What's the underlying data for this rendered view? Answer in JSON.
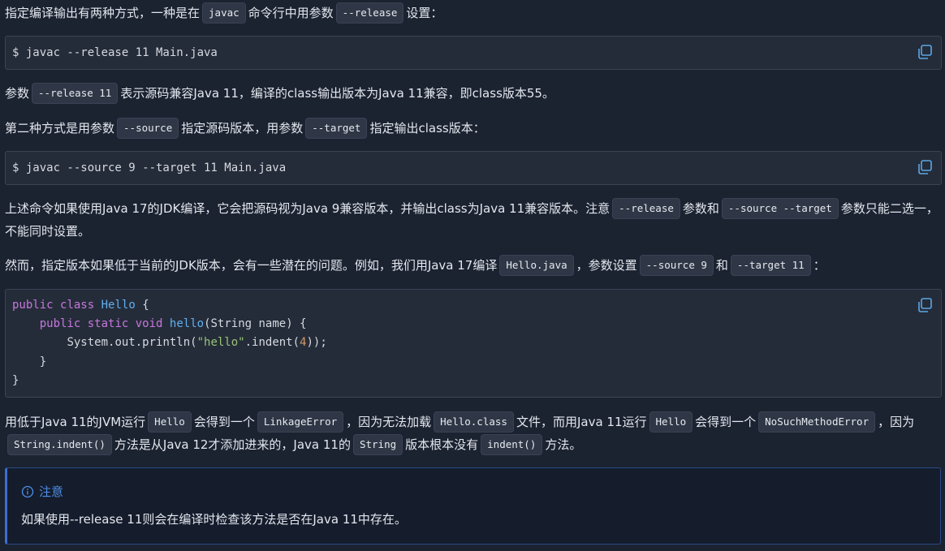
{
  "p1": {
    "t1": "指定编译输出有两种方式，一种是在",
    "c1": "javac",
    "t2": "命令行中用参数",
    "c2": "--release",
    "t3": "设置："
  },
  "code1": {
    "line": "$ javac --release 11 Main.java"
  },
  "p2": {
    "t1": "参数",
    "c1": "--release 11",
    "t2": "表示源码兼容Java 11，编译的class输出版本为Java 11兼容，即class版本55。"
  },
  "p3": {
    "t1": "第二种方式是用参数",
    "c1": "--source",
    "t2": "指定源码版本，用参数",
    "c2": "--target",
    "t3": "指定输出class版本："
  },
  "code2": {
    "line": "$ javac --source 9 --target 11 Main.java"
  },
  "p4": {
    "t1": "上述命令如果使用Java 17的JDK编译，它会把源码视为Java 9兼容版本，并输出class为Java 11兼容版本。注意",
    "c1": "--release",
    "t2": "参数和",
    "c2": "--source --target",
    "t3": "参数只能二选一，不能同时设置。"
  },
  "p5": {
    "t1": "然而，指定版本如果低于当前的JDK版本，会有一些潜在的问题。例如，我们用Java 17编译",
    "c1": "Hello.java",
    "t2": "，参数设置",
    "c2": "--source 9",
    "t3": "和",
    "c3": "--target 11",
    "t4": "："
  },
  "code3": {
    "l1_kw1": "public",
    "l1_kw2": "class",
    "l1_cls": "Hello",
    "l1_rest": "{",
    "l2_kw1": "public",
    "l2_kw2": "static",
    "l2_kw3": "void",
    "l2_fn": "hello",
    "l2_rest": "(String name) {",
    "l3_a": "System.out.println(",
    "l3_str": "\"hello\"",
    "l3_b": ".indent(",
    "l3_num": "4",
    "l3_c": "));",
    "l4": "}",
    "l5": "}"
  },
  "p6": {
    "t1": "用低于Java 11的JVM运行",
    "c1": "Hello",
    "t2": "会得到一个",
    "c2": "LinkageError",
    "t3": "，因为无法加载",
    "c3": "Hello.class",
    "t4": "文件，而用Java 11运行",
    "c4": "Hello",
    "t5": "会得到一个",
    "c5": "NoSuchMethodError",
    "t6": "，因为",
    "c6": "String.indent()",
    "t7": "方法是从Java 12才添加进来的，Java 11的",
    "c7": "String",
    "t8": "版本根本没有",
    "c8": "indent()",
    "t9": "方法。"
  },
  "callout": {
    "title": "注意",
    "body": "如果使用--release 11则会在编译时检查该方法是否在Java 11中存在。"
  },
  "colors": {
    "background": "#1b2230",
    "code_background": "#252c39",
    "callout_accent": "#3b6fd1",
    "keyword": "#c678dd",
    "class_name": "#61afef",
    "string": "#98c379",
    "number": "#d19a66"
  },
  "icons": {
    "copy": "copy-icon",
    "info": "info-icon"
  }
}
